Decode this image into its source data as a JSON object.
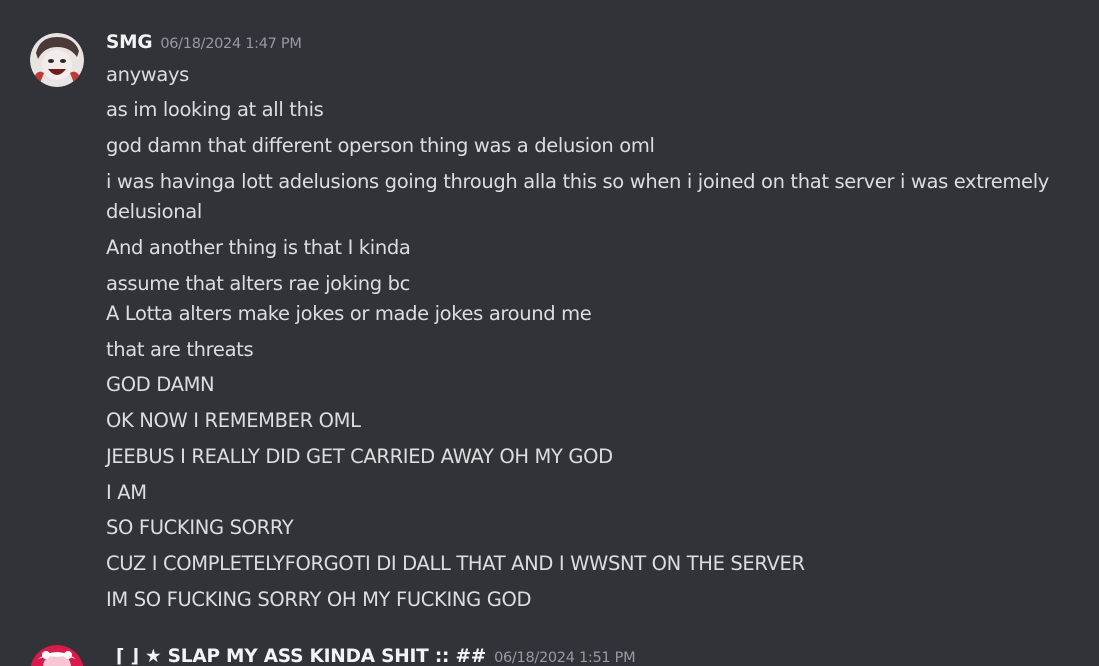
{
  "message1": {
    "username": "SMG",
    "timestamp": "06/18/2024 1:47 PM",
    "lines": [
      "anyways",
      "as im looking at all this",
      "god damn that different operson thing was a delusion oml",
      "i was havinga  lott adelusions going through alla this so when i joined on that server i was extremely delusional",
      "And another thing is that I kinda",
      "assume that alters rae joking bc",
      "A Lotta alters make jokes or made jokes around me",
      "that are threats",
      "GOD DAMN",
      "OK NOW I REMEMBER OML",
      "JEEBUS I REALLY DID GET CARRIED AWAY OH MY GOD",
      "I AM",
      "SO FUCKING SORRY",
      "CUZ I COMPLETELYFORGOTI DI DALL THAT AND I WWSNT ON THE SERVER",
      "IM SO FUCKING SORRY OH MY FUCKING GOD"
    ]
  },
  "message2": {
    "username": "⌈ ⌋ ★ SLAP MY ASS KINDA SHIT :: ##",
    "timestamp": "06/18/2024 1:51 PM"
  },
  "colors": {
    "background": "#313338",
    "text": "#dbdee1",
    "username": "#f2f3f5",
    "timestamp": "#949ba4"
  }
}
